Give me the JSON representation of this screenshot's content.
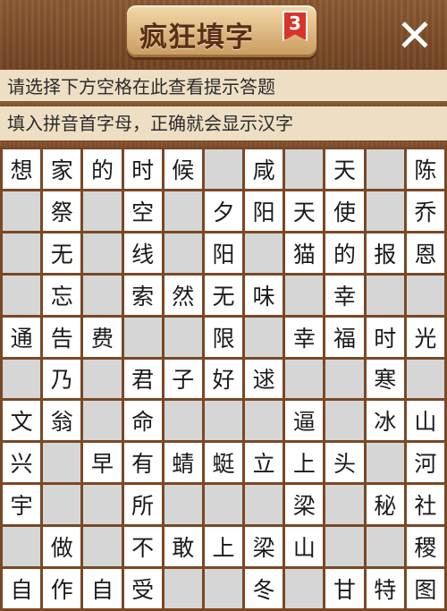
{
  "header": {
    "title": "疯狂填字",
    "level": "3",
    "close_label": "✕"
  },
  "hints": {
    "line1": "请选择下方空格在此查看提示答题",
    "line2": "填入拼音首字母，正确就会显示汉字"
  },
  "colors": {
    "board_border": "#7a4825",
    "filled_cell": "#ffffff",
    "blocked_cell": "#d6d6d6",
    "hint_bg": "#eedfc4",
    "badge": "#d8342a"
  },
  "grid": [
    [
      "想",
      "家",
      "的",
      "时",
      "候",
      "#",
      "咸",
      "#",
      "天",
      "#",
      "陈"
    ],
    [
      "#",
      "祭",
      "#",
      "空",
      "#",
      "夕",
      "阳",
      "天",
      "使",
      "#",
      "乔"
    ],
    [
      "#",
      "无",
      "#",
      "线",
      "#",
      "阳",
      "#",
      "猫",
      "的",
      "报",
      "恩"
    ],
    [
      "#",
      "忘",
      "#",
      "索",
      "然",
      "无",
      "味",
      "#",
      "幸",
      "#",
      "#"
    ],
    [
      "通",
      "告",
      "费",
      "#",
      "#",
      "限",
      "#",
      "幸",
      "福",
      "时",
      "光"
    ],
    [
      "#",
      "乃",
      "#",
      "君",
      "子",
      "好",
      "逑",
      "#",
      "#",
      "寒",
      "#"
    ],
    [
      "文",
      "翁",
      "#",
      "命",
      "#",
      "#",
      "#",
      "逼",
      "#",
      "冰",
      "山"
    ],
    [
      "兴",
      "#",
      "早",
      "有",
      "蜻",
      "蜓",
      "立",
      "上",
      "头",
      "#",
      "河"
    ],
    [
      "宇",
      "#",
      "#",
      "所",
      "#",
      "#",
      "#",
      "梁",
      "#",
      "秘",
      "社"
    ],
    [
      "#",
      "做",
      "#",
      "不",
      "敢",
      "上",
      "梁",
      "山",
      "#",
      "#",
      "稷"
    ],
    [
      "自",
      "作",
      "自",
      "受",
      "#",
      "#",
      "冬",
      "#",
      "甘",
      "特",
      "图"
    ]
  ]
}
